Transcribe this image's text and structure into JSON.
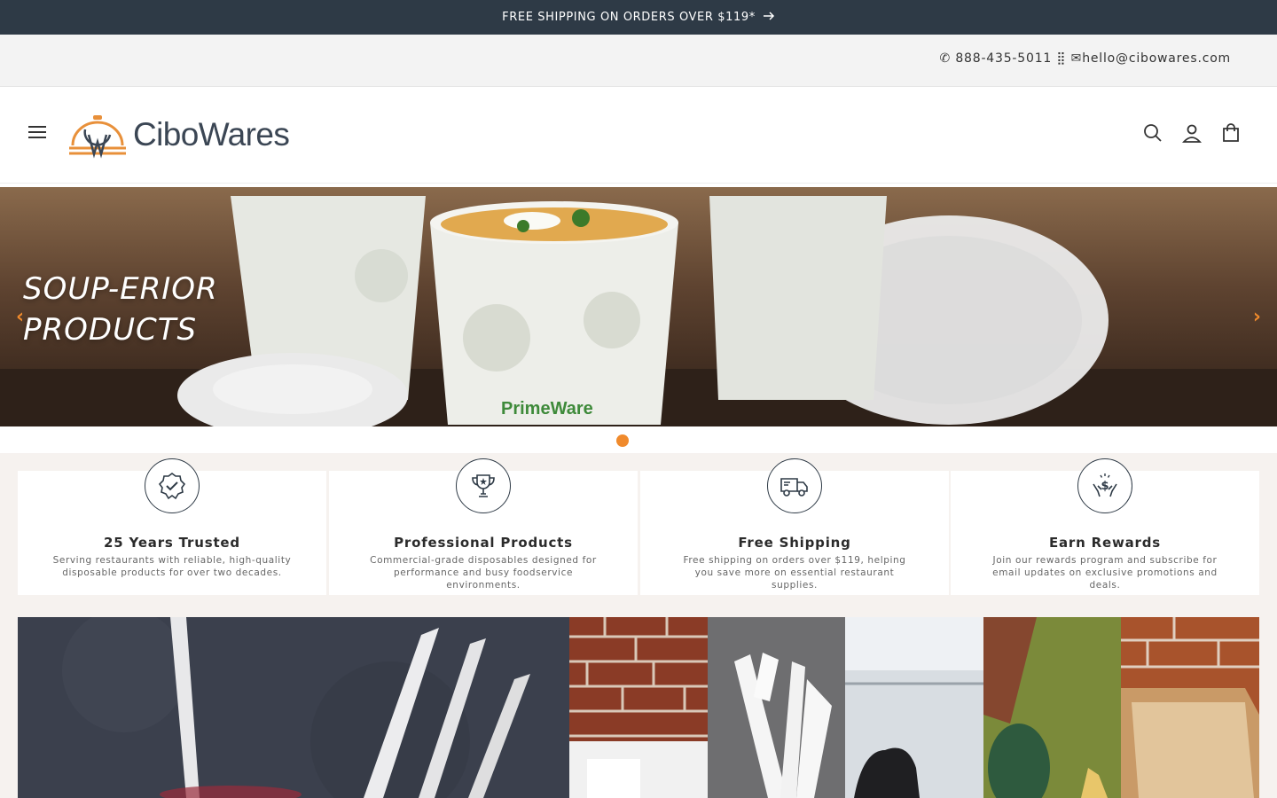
{
  "announcement": {
    "text": "FREE SHIPPING ON ORDERS OVER $119*",
    "arrow_icon": "arrow-right-icon"
  },
  "utility": {
    "contact": "✆ 888-435-5011 ⣿ ✉hello@cibowares.com"
  },
  "header": {
    "logo_text": "CiboWares",
    "icons": [
      "menu-icon",
      "search-icon",
      "account-icon",
      "cart-icon"
    ]
  },
  "hero": {
    "tagline_line1": "SOUP-ERIOR",
    "tagline_line2": "PRODUCTS",
    "brand_mark": "PrimeWare",
    "prev_icon": "chevron-left-icon",
    "next_icon": "chevron-right-icon"
  },
  "features": [
    {
      "title": "25 Years Trusted",
      "text": "Serving restaurants with reliable, high-quality disposable products for over two decades.",
      "icon": "verified-badge-icon"
    },
    {
      "title": "Professional Products",
      "text": "Commercial-grade disposables designed for performance and busy foodservice environments.",
      "icon": "trophy-icon"
    },
    {
      "title": "Free Shipping",
      "text": "Free shipping on orders over $119, helping you save more on essential restaurant supplies.",
      "icon": "delivery-truck-icon"
    },
    {
      "title": "Earn Rewards",
      "text": "Join our rewards program and subscribe for email updates on exclusive promotions and deals.",
      "icon": "rewards-hands-icon"
    }
  ],
  "colors": {
    "accent": "#f08a2c",
    "dark": "#2e3a46",
    "section_bg": "#f6f2ef"
  }
}
